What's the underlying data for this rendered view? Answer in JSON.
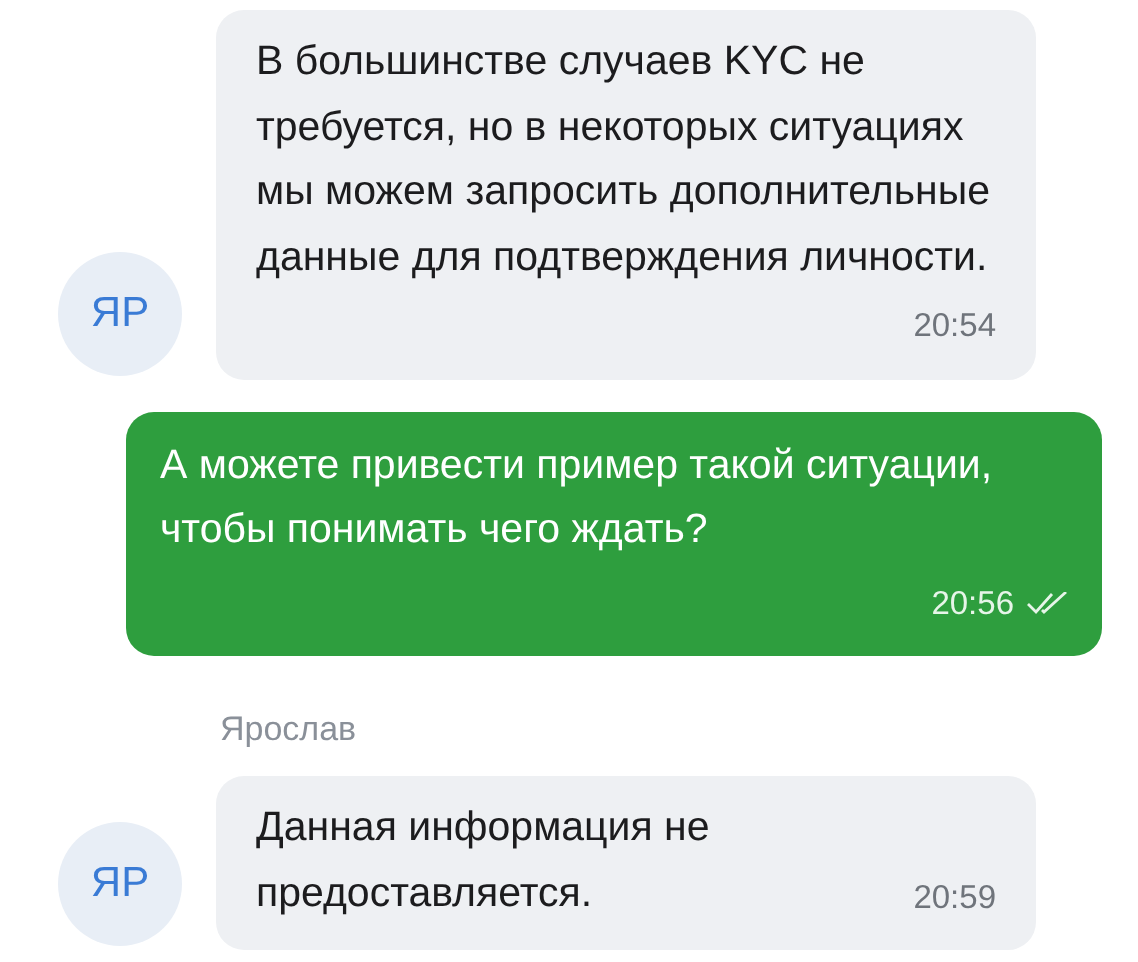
{
  "messages": [
    {
      "kind": "incoming",
      "avatar": "ЯР",
      "text": "В большинстве случаев KYC не требуется, но в некоторых ситуациях мы можем запросить дополнительные данные для подтверждения личности.",
      "time": "20:54"
    },
    {
      "kind": "outgoing",
      "text": "А можете привести пример такой ситуации, чтобы понимать чего ждать?",
      "time": "20:56",
      "read": true
    },
    {
      "kind": "incoming",
      "sender": "Ярослав",
      "avatar": "ЯР",
      "text": "Данная информация не предоставляется.",
      "time": "20:59"
    }
  ]
}
